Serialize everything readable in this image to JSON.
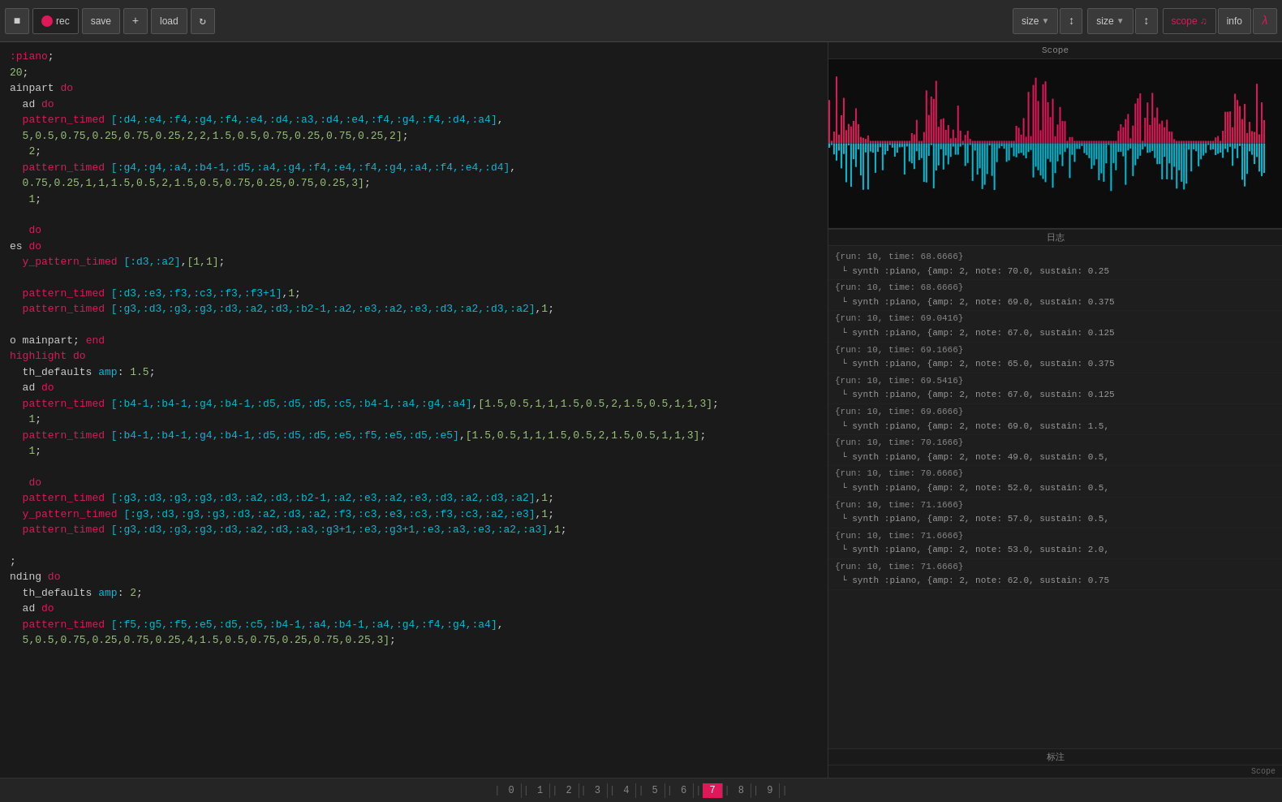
{
  "toolbar": {
    "rec_label": "rec",
    "save_label": "save",
    "load_label": "load",
    "size_label1": "size",
    "size_label2": "size",
    "scope_label": "scope",
    "info_label": "info"
  },
  "scope": {
    "title": "Scope"
  },
  "log": {
    "section1_label": "日志",
    "section2_label": "标注",
    "entries": [
      {
        "run": "{run: 10, time: 68.6666}",
        "synth": "└ synth :piano, {amp: 2, note: 70.0, sustain: 0.25"
      },
      {
        "run": "{run: 10, time: 68.6666}",
        "synth": "└ synth :piano, {amp: 2, note: 69.0, sustain: 0.375"
      },
      {
        "run": "{run: 10, time: 69.0416}",
        "synth": "└ synth :piano, {amp: 2, note: 67.0, sustain: 0.125"
      },
      {
        "run": "{run: 10, time: 69.1666}",
        "synth": "└ synth :piano, {amp: 2, note: 65.0, sustain: 0.375"
      },
      {
        "run": "{run: 10, time: 69.5416}",
        "synth": "└ synth :piano, {amp: 2, note: 67.0, sustain: 0.125"
      },
      {
        "run": "{run: 10, time: 69.6666}",
        "synth": "└ synth :piano, {amp: 2, note: 69.0, sustain: 1.5,"
      },
      {
        "run": "{run: 10, time: 70.1666}",
        "synth": "└ synth :piano, {amp: 2, note: 49.0, sustain: 0.5,"
      },
      {
        "run": "{run: 10, time: 70.6666}",
        "synth": "└ synth :piano, {amp: 2, note: 52.0, sustain: 0.5,"
      },
      {
        "run": "{run: 10, time: 71.1666}",
        "synth": "└ synth :piano, {amp: 2, note: 57.0, sustain: 0.5,"
      },
      {
        "run": "{run: 10, time: 71.6666}",
        "synth": "└ synth :piano, {amp: 2, note: 53.0, sustain: 2.0,"
      },
      {
        "run": "{run: 10, time: 71.6666}",
        "synth": "└ synth :piano, {amp: 2, note: 62.0, sustain: 0.75"
      }
    ]
  },
  "code": {
    "lines": [
      ":piano;",
      "20;",
      "ainpart do",
      "ad do",
      "pattern_timed [:d4,:e4,:f4,:g4,:f4,:e4,:d4,:a3,:d4,:e4,:f4,:g4,:f4,:d4,:a4],",
      "5,0.5,0.75,0.25,0.75,0.25,2,2,1.5,0.5,0.75,0.25,0.75,0.25,2];",
      " 2;",
      "pattern_timed [:g4,:g4,:a4,:b4-1,:d5,:a4,:g4,:f4,:e4,:f4,:g4,:a4,:f4,:e4,:d4],",
      "0.75,0.25,1,1,1.5,0.5,2,1.5,0.5,0.75,0.25,0.75,0.25,3];",
      " 1;",
      "",
      " do",
      "es do",
      "y_pattern_timed [:d3,:a2],[1,1];",
      "",
      "pattern_timed [:d3,:e3,:f3,:c3,:f3,:f3+1],1;",
      "pattern_timed [:g3,:d3,:g3,:g3,:d3,:a2,:d3,:b2-1,:a2,:e3,:a2,:e3,:d3,:a2,:d3,:a2],1;",
      "",
      "o mainpart; end",
      "highlight do",
      "th_defaults amp: 1.5;",
      "ad do",
      "pattern_timed [:b4-1,:b4-1,:g4,:b4-1,:d5,:d5,:d5,:c5,:b4-1,:a4,:g4,:a4],[1.5,0.5,1,1,1.5,0.5,2,1.5,0.5,1,1,3];",
      " 1;",
      "pattern_timed [:b4-1,:b4-1,:g4,:b4-1,:d5,:d5,:d5,:e5,:f5,:e5,:d5,:e5],[1.5,0.5,1,1,1.5,0.5,2,1.5,0.5,1,1,3];",
      " 1;",
      "",
      " do",
      "pattern_timed [:g3,:d3,:g3,:g3,:d3,:a2,:d3,:b2-1,:a2,:e3,:a2,:e3,:d3,:a2,:d3,:a2],1;",
      "y_pattern_timed [:g3,:d3,:g3,:g3,:d3,:a2,:d3,:a2,:f3,:c3,:e3,:c3,:f3,:c3,:a2,:e3],1;",
      "pattern_timed [:g3,:d3,:g3,:g3,:d3,:a2,:d3,:a3,:g3+1,:e3,:g3+1,:e3,:a3,:e3,:a2,:a3],1;",
      "",
      ";",
      "nding do",
      "th_defaults amp: 2;",
      "ad do",
      "pattern_timed [:f5,:g5,:f5,:e5,:d5,:c5,:b4-1,:a4,:b4-1,:a4,:g4,:f4,:g4,:a4],",
      "5,0.5,0.75,0.25,0.75,0.25,4,1.5,0.5,0.75,0.25,0.75,0.25,3];"
    ]
  },
  "pages": [
    {
      "label": "0",
      "active": false
    },
    {
      "label": "1",
      "active": false
    },
    {
      "label": "2",
      "active": false
    },
    {
      "label": "3",
      "active": false
    },
    {
      "label": "4",
      "active": false
    },
    {
      "label": "5",
      "active": false
    },
    {
      "label": "6",
      "active": false
    },
    {
      "label": "7",
      "active": true
    },
    {
      "label": "8",
      "active": false
    },
    {
      "label": "9",
      "active": false
    }
  ],
  "colors": {
    "pink": "#e0185a",
    "cyan": "#00bcd4",
    "bg_dark": "#1a1a1a",
    "bg_mid": "#1e1e1e"
  }
}
